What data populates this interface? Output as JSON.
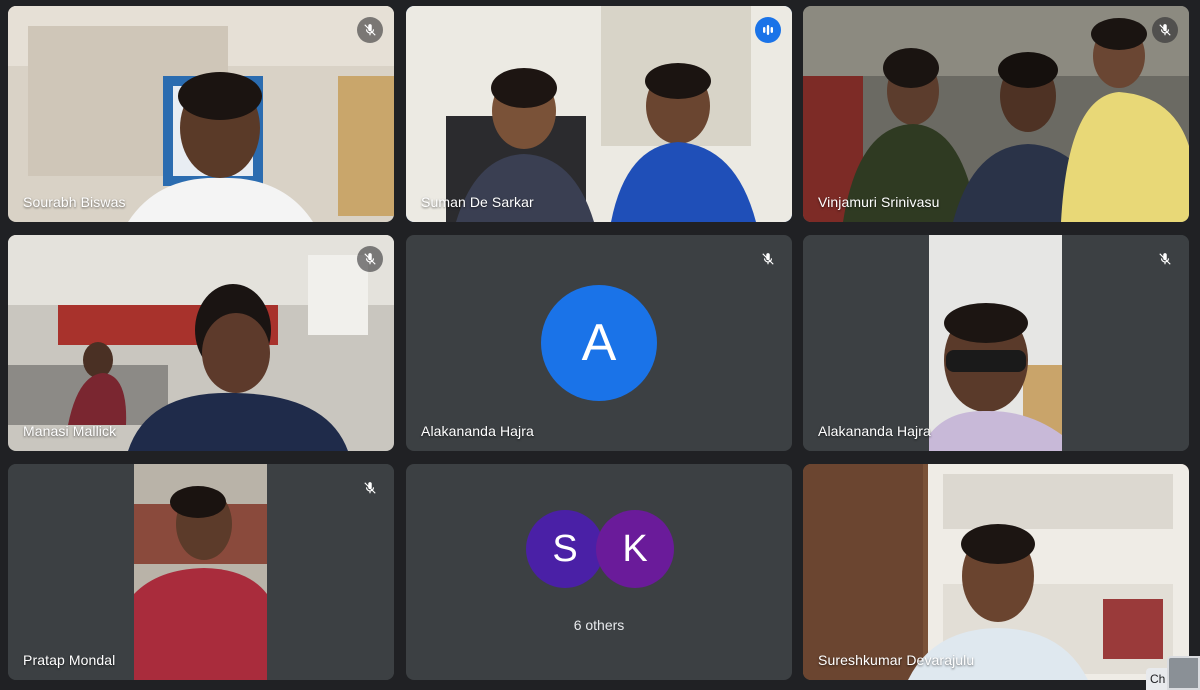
{
  "participants": [
    {
      "name": "Sourabh Biswas",
      "status": "muted"
    },
    {
      "name": "Suman De Sarkar",
      "status": "speaking"
    },
    {
      "name": "Vinjamuri Srinivasu",
      "status": "muted"
    },
    {
      "name": "Manasi Mallick",
      "status": "muted"
    },
    {
      "name": "Alakananda Hajra",
      "status": "muted",
      "avatar_letter": "A",
      "avatar_color": "#1a73e8"
    },
    {
      "name": "Alakananda Hajra",
      "status": "muted"
    },
    {
      "name": "Pratap Mondal",
      "status": "muted"
    },
    {
      "name": "Sureshkumar Devarajulu",
      "status": "unmuted"
    }
  ],
  "others": {
    "label": "6 others",
    "avatars": [
      {
        "letter": "S",
        "color": "#4a20a6"
      },
      {
        "letter": "K",
        "color": "#6a1b9a"
      }
    ]
  },
  "chip_label": "Ch",
  "colors": {
    "background": "#202124",
    "tile": "#3c4043",
    "speaking_border": "#4b8ff5"
  },
  "icons": {
    "muted": "mic-off-icon",
    "speaking": "audio-level-icon"
  }
}
